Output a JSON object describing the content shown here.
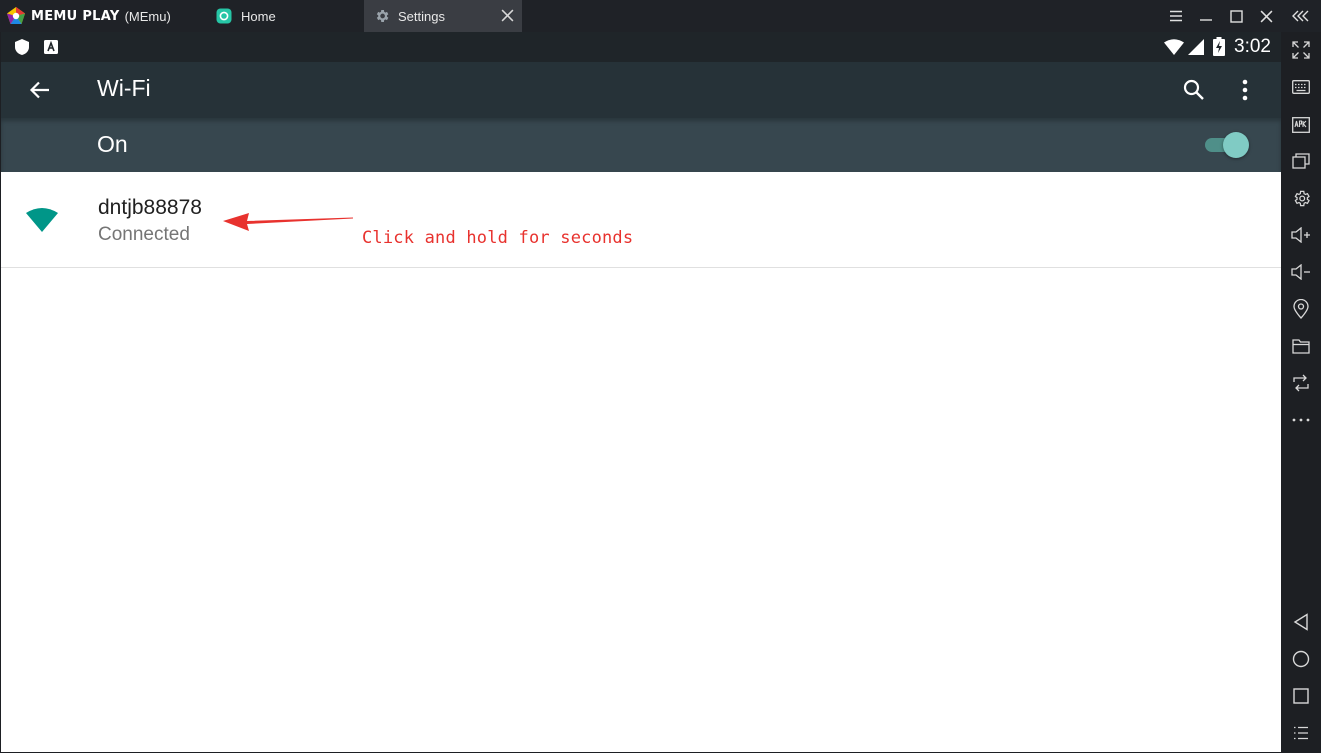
{
  "window": {
    "brand": "MEMU PLAY",
    "brand_sub": "(MEmu)",
    "tabs": [
      {
        "label": "Home",
        "icon": "home-app-icon"
      },
      {
        "label": "Settings",
        "icon": "gear-icon",
        "active": true
      }
    ]
  },
  "statusbar": {
    "time": "3:02"
  },
  "page": {
    "title": "Wi-Fi"
  },
  "wifi_toggle": {
    "label": "On",
    "enabled": true
  },
  "networks": [
    {
      "name": "dntjb88878",
      "status": "Connected"
    }
  ],
  "annotation": {
    "text": "Click and hold for seconds"
  },
  "colors": {
    "accent": "#80cbc4",
    "wifi_icon": "#009688",
    "annotation": "#e8322e",
    "appbar": "#263238",
    "togglebar": "#37474f"
  }
}
